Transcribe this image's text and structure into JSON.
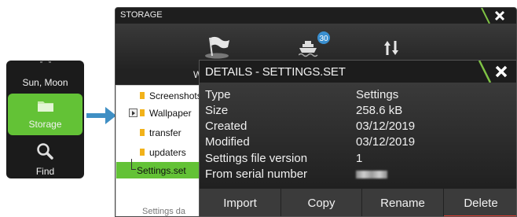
{
  "side_menu": {
    "items": [
      {
        "label": "Sun, Moon",
        "icon": "sun-moon-icon"
      },
      {
        "label": "Storage",
        "icon": "folder-icon",
        "selected": true
      },
      {
        "label": "Find",
        "icon": "magnifier-icon"
      }
    ]
  },
  "storage_window": {
    "title": "STORAGE",
    "top_icons": [
      "waypoint-flag-icon",
      "vessel-icon",
      "transfer-arrows-icon"
    ],
    "badge": "30",
    "waypoints_label": "Way",
    "tree": {
      "items": [
        {
          "label": "Screenshots",
          "type": "folder"
        },
        {
          "label": "Wallpaper",
          "type": "folder",
          "expandable": true
        },
        {
          "label": "transfer",
          "type": "folder"
        },
        {
          "label": "updaters",
          "type": "folder"
        },
        {
          "label": "Settings.set",
          "type": "file",
          "selected": true
        }
      ]
    },
    "partial_item": "Settings da"
  },
  "details_dialog": {
    "title": "DETAILS - SETTINGS.SET",
    "rows": [
      {
        "key": "Type",
        "value": "Settings"
      },
      {
        "key": "Size",
        "value": "258.6 kB"
      },
      {
        "key": "Created",
        "value": "03/12/2019"
      },
      {
        "key": "Modified",
        "value": "03/12/2019"
      },
      {
        "key": "Settings file version",
        "value": "1"
      },
      {
        "key": "From serial number",
        "value": ""
      }
    ],
    "buttons": {
      "import": "Import",
      "copy": "Copy",
      "rename": "Rename",
      "delete": "Delete"
    }
  },
  "colors": {
    "accent_green": "#63c236",
    "delete_red": "#e53a2f",
    "dialog_bg": "#2b2b2b"
  }
}
